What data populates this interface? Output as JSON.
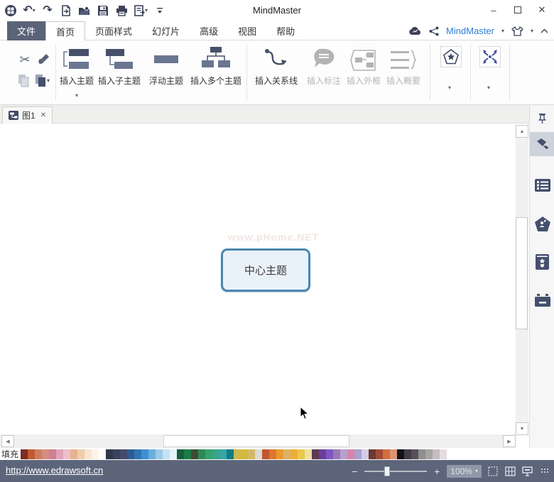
{
  "window": {
    "title": "MindMaster",
    "minimize": "–",
    "close": "✕"
  },
  "glyphs": {
    "undo": "↶",
    "redo": "↷",
    "scissors": "✂",
    "dropdown": "▾",
    "up_small": "▲",
    "down_small": "▼",
    "left_small": "◀",
    "right_small": "▶",
    "tab_close": "✕"
  },
  "quick_access": {
    "buttons": [
      "app-logo",
      "undo",
      "redo",
      "new-document",
      "open",
      "save",
      "print",
      "export",
      "customize-toolbar"
    ]
  },
  "menu": {
    "tabs": [
      "文件",
      "首页",
      "页面样式",
      "幻灯片",
      "高级",
      "视图",
      "帮助"
    ],
    "active_tab": "首页"
  },
  "account": {
    "name": "MindMaster"
  },
  "ribbon": {
    "topic_buttons": [
      {
        "label": "插入主题",
        "enabled": true,
        "dropdown": true
      },
      {
        "label": "插入子主题",
        "enabled": true,
        "dropdown": false
      },
      {
        "label": "浮动主题",
        "enabled": true,
        "dropdown": false
      },
      {
        "label": "插入多个主题",
        "enabled": true,
        "dropdown": false
      }
    ],
    "relation_buttons": [
      {
        "label": "插入关系线",
        "enabled": true
      },
      {
        "label": "插入标注",
        "enabled": false
      },
      {
        "label": "插入外框",
        "enabled": false
      },
      {
        "label": "插入概要",
        "enabled": false
      }
    ]
  },
  "document_tabs": {
    "tabs": [
      {
        "label": "图1"
      }
    ]
  },
  "canvas": {
    "central_topic": "中心主题",
    "watermark": "www.pHome.NET"
  },
  "palette": {
    "label": "填充",
    "colors": [
      "#7a2e23",
      "#c25a2e",
      "#cd7d62",
      "#d68d80",
      "#ce7f95",
      "#e1a3b6",
      "#ecc0cb",
      "#e7b28e",
      "#efcda9",
      "#f7e5cf",
      "#fdf4e8",
      "#fffdf9",
      "#30374a",
      "#3a415c",
      "#434c6e",
      "#2f5b8f",
      "#2e75b6",
      "#3f8fd2",
      "#6aaede",
      "#9ccaea",
      "#c6e0f2",
      "#e6f1f9",
      "#155e3a",
      "#1d7a46",
      "#3d4a33",
      "#2d8a57",
      "#35a16b",
      "#3aa489",
      "#36a6a6",
      "#0f7d85",
      "#cdb84e",
      "#d4ba37",
      "#d0b96a",
      "#dcd9d2",
      "#c2572f",
      "#e0762f",
      "#ea9a2d",
      "#dcb269",
      "#ecae3a",
      "#e9c94b",
      "#ece3a0",
      "#5c3a52",
      "#6a3d9a",
      "#7e57c2",
      "#9779b5",
      "#b89fce",
      "#d883aa",
      "#a8a0cd",
      "#d3cce6",
      "#6b3a2e",
      "#a04a37",
      "#cf6f3d",
      "#dd9270",
      "#11131c",
      "#413c46",
      "#575059",
      "#8f8f8f",
      "#a6a3a3",
      "#c4bec2",
      "#e5dce0"
    ]
  },
  "status_bar": {
    "link": "http://www.edrawsoft.cn",
    "zoom_level": "100%",
    "minus": "−",
    "plus": "+"
  },
  "theme": {
    "accent_blue": "#2e7cd6",
    "topic_border": "#4a87b0",
    "topic_fill": "#eaf2f9",
    "statusbar_bg": "#5c657a",
    "icon_dark": "#47506a",
    "file_tab_bg": "#5a6378"
  }
}
